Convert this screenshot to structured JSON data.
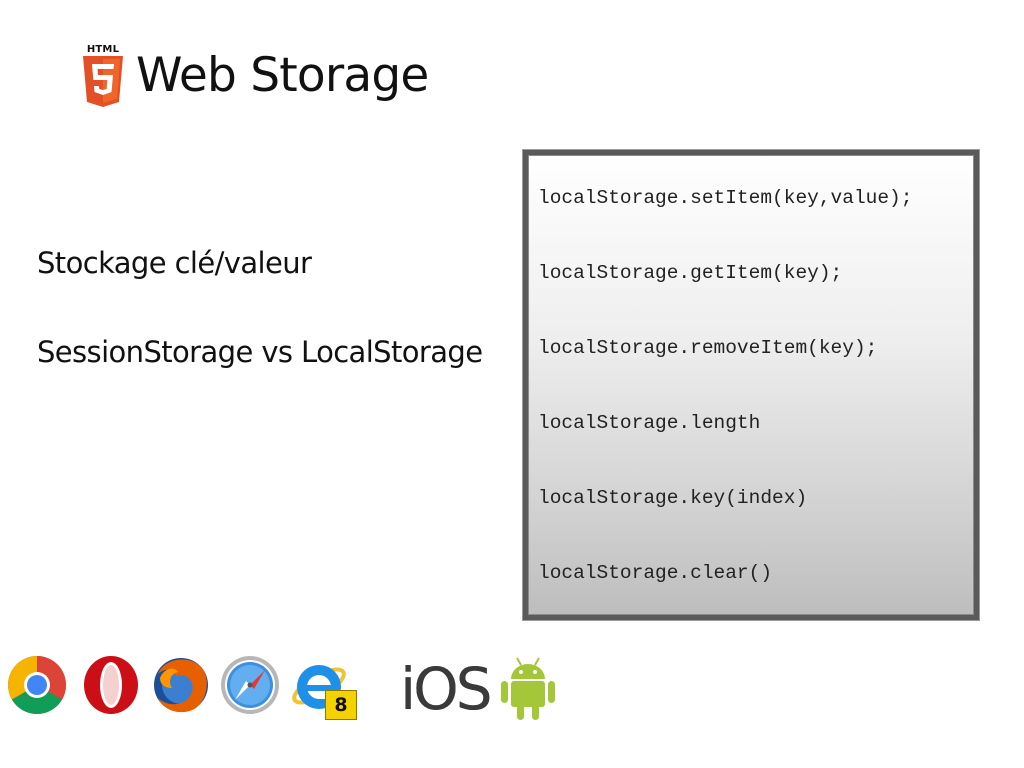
{
  "slide": {
    "logo_text": "HTML",
    "logo_number": "5",
    "title": "Web Storage",
    "bullets": [
      "Stockage clé/valeur",
      "SessionStorage vs LocalStorage"
    ],
    "code_lines": [
      "localStorage.setItem(key,value);",
      "localStorage.getItem(key);",
      "localStorage.removeItem(key);",
      "localStorage.length",
      "localStorage.key(index)",
      "localStorage.clear()"
    ]
  },
  "browsers": {
    "icons": [
      "chrome-icon",
      "opera-icon",
      "firefox-icon",
      "safari-icon",
      "internet-explorer-icon"
    ],
    "ie_version": "8",
    "platforms": {
      "ios_label": "iOS",
      "android_icon": "android-icon"
    }
  },
  "colors": {
    "html5_orange": "#e34f26",
    "html5_light": "#f06529",
    "ie_badge": "#f6d100",
    "android_green": "#a4c639"
  }
}
